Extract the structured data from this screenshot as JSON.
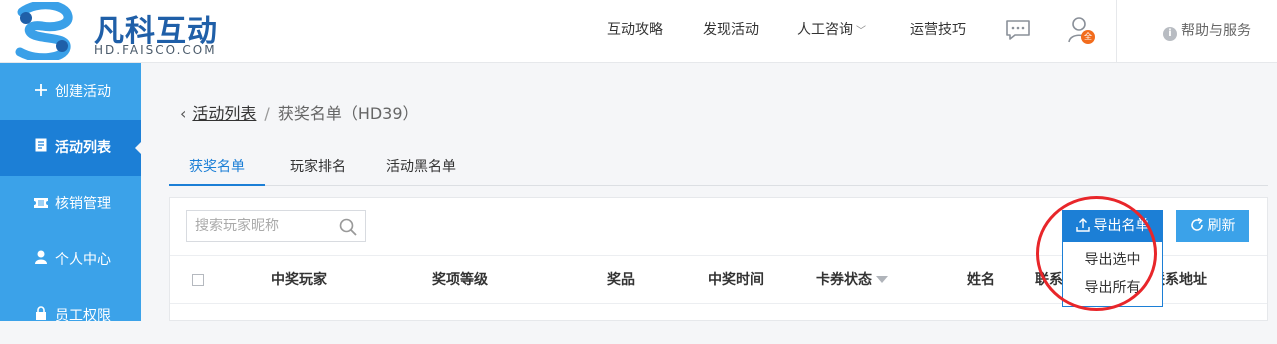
{
  "brand": {
    "name": "凡科互动",
    "sub": "HD.FAISCO.COM"
  },
  "nav": {
    "items": [
      "互动攻略",
      "发现活动",
      "人工咨询",
      "运营技巧"
    ],
    "user_badge": "全",
    "help": "帮助与服务"
  },
  "sidebar": {
    "items": [
      {
        "label": "创建活动",
        "icon": "plus-icon"
      },
      {
        "label": "活动列表",
        "icon": "list-icon"
      },
      {
        "label": "核销管理",
        "icon": "ticket-icon"
      },
      {
        "label": "个人中心",
        "icon": "person-icon"
      },
      {
        "label": "员工权限",
        "icon": "lock-icon"
      }
    ]
  },
  "breadcrumb": {
    "parent": "活动列表",
    "sep": "/",
    "current": "获奖名单（HD39）"
  },
  "tabs": [
    "获奖名单",
    "玩家排名",
    "活动黑名单"
  ],
  "search": {
    "placeholder": "搜索玩家昵称",
    "value": ""
  },
  "toolbar": {
    "export_label": "导出名单",
    "refresh_label": "刷新"
  },
  "dropdown": {
    "items": [
      "导出选中",
      "导出所有"
    ]
  },
  "table": {
    "headers": [
      "中奖玩家",
      "奖项等级",
      "奖品",
      "中奖时间",
      "卡券状态",
      "姓名",
      "联系",
      "联系地址"
    ]
  },
  "colors": {
    "primary": "#1c7fd6",
    "sidebar": "#3ba2e9",
    "annotation": "#e8262a",
    "badge": "#f26c1d"
  }
}
